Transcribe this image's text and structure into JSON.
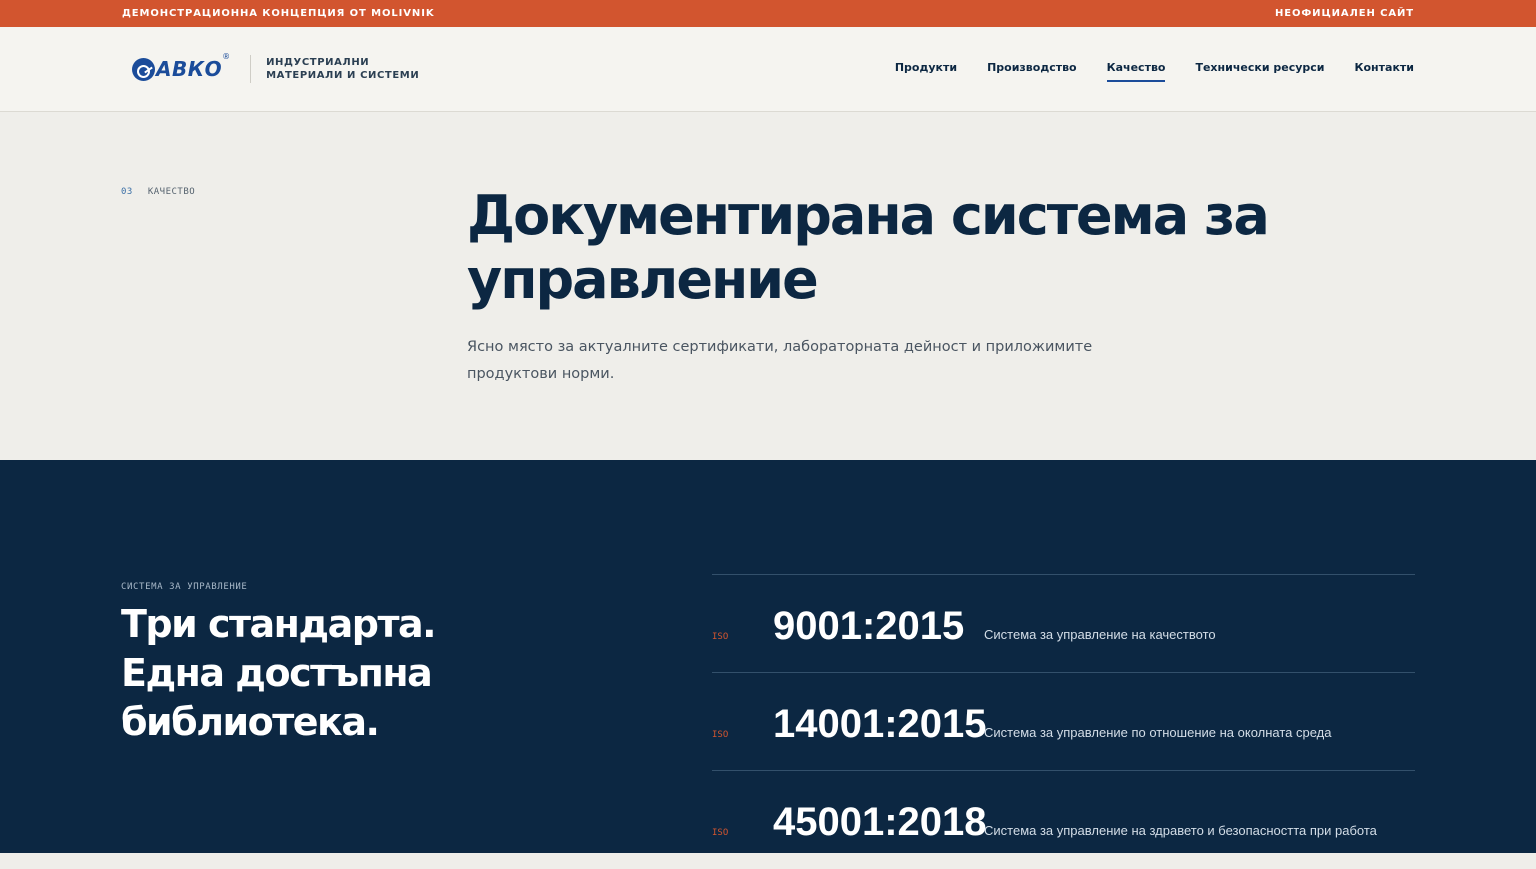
{
  "topbar": {
    "left": "ДЕМОНСТРАЦИОННА КОНЦЕПЦИЯ ОТ MOLIVNIK",
    "right": "НЕОФИЦИАЛЕН САЙТ"
  },
  "header": {
    "logo_text": "АВКО",
    "logo_reg": "®",
    "logo_icon": "avko-logo-icon",
    "tagline_line1": "ИНДУСТРИАЛНИ",
    "tagline_line2": "МАТЕРИАЛИ И СИСТЕМИ",
    "nav": [
      {
        "label": "Продукти",
        "active": false
      },
      {
        "label": "Производство",
        "active": false
      },
      {
        "label": "Качество",
        "active": true
      },
      {
        "label": "Технически ресурси",
        "active": false
      },
      {
        "label": "Контакти",
        "active": false
      }
    ]
  },
  "hero": {
    "crumb_number": "03",
    "crumb_label": "КАЧЕСТВО",
    "title": "Документирана система за управление",
    "lead": "Ясно място за актуалните сертификати, лабораторната дейност и приложимите продуктови норми."
  },
  "management": {
    "eyebrow": "СИСТЕМА ЗА УПРАВЛЕНИЕ",
    "title": "Три стандарта. Една достъпна библиотека.",
    "standards": [
      {
        "prefix": "ISO",
        "code": "9001:2015",
        "description": "Система за управление на качеството"
      },
      {
        "prefix": "ISO",
        "code": "14001:2015",
        "description": "Система за управление по отношение на околната среда"
      },
      {
        "prefix": "ISO",
        "code": "45001:2018",
        "description": "Система за управление на здравето и безопасността при работа"
      }
    ]
  },
  "colors": {
    "accent": "#d2552f",
    "navy": "#0c2742",
    "brand_blue": "#1b4c9a",
    "background": "#efeeea"
  }
}
